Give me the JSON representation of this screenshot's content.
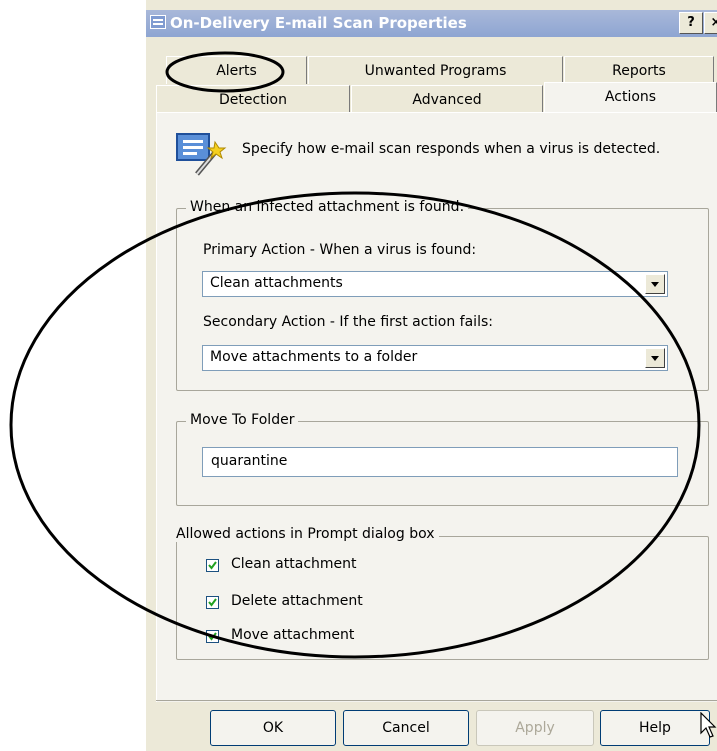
{
  "window": {
    "title": "On-Delivery E-mail Scan Properties",
    "help_button": "?",
    "close_button": "×"
  },
  "tabs": {
    "row1": [
      "Alerts",
      "Unwanted Programs",
      "Reports"
    ],
    "row2": [
      "Detection",
      "Advanced",
      "Actions"
    ],
    "active": "Actions"
  },
  "info": {
    "text": "Specify how e-mail scan responds when a virus is detected.",
    "icon": "settings-wand-icon"
  },
  "infected_group": {
    "legend": "When an infected attachment is found:",
    "primary_label": "Primary Action - When a virus is found:",
    "primary_value": "Clean attachments",
    "secondary_label": "Secondary Action - If the first action fails:",
    "secondary_value": "Move attachments to a folder"
  },
  "move_group": {
    "legend": "Move To Folder",
    "folder_value": "quarantine"
  },
  "prompt_group": {
    "legend": "Allowed actions in Prompt dialog box",
    "options": [
      {
        "label": "Clean attachment",
        "checked": true
      },
      {
        "label": "Delete attachment",
        "checked": true
      },
      {
        "label": "Move attachment",
        "checked": true
      }
    ]
  },
  "buttons": {
    "ok": "OK",
    "cancel": "Cancel",
    "apply": "Apply",
    "help": "Help"
  },
  "annotations": {
    "color": "#000000"
  }
}
